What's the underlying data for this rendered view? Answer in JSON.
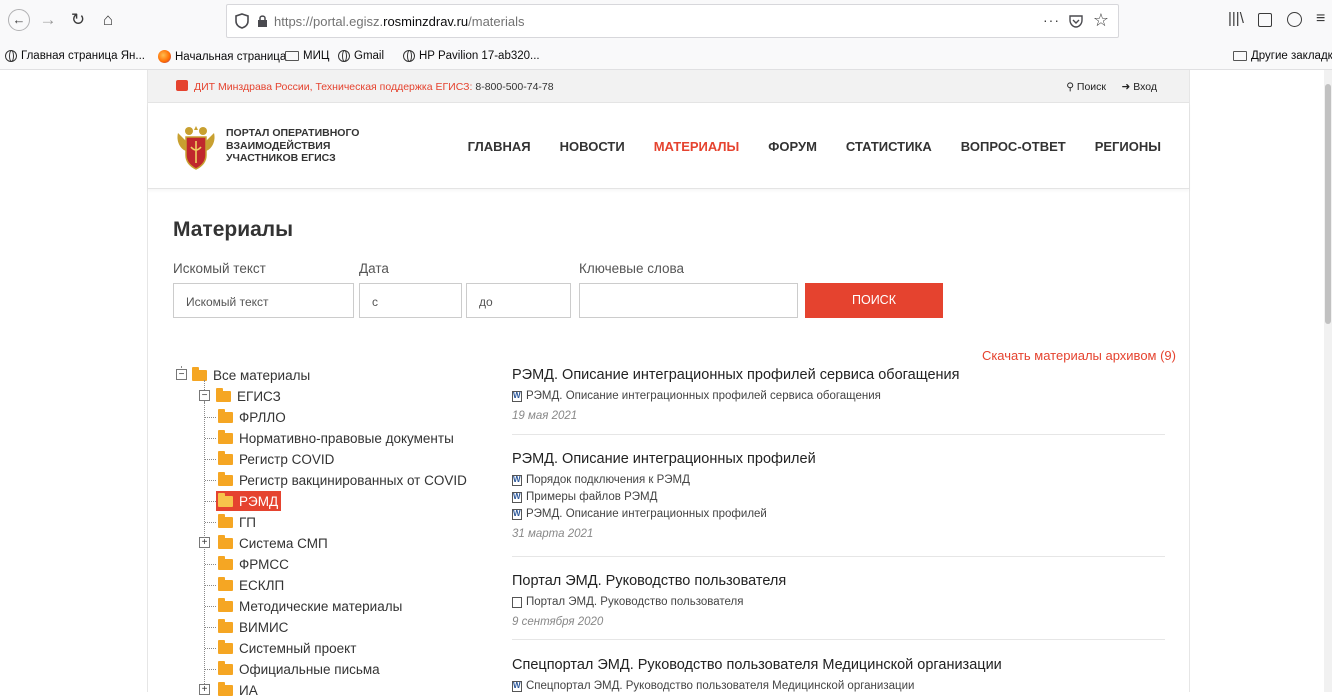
{
  "browser": {
    "url_prefix": "https://portal.egisz.",
    "url_host": "rosminzdrav.ru",
    "url_suffix": "/materials",
    "more": "···",
    "bookmarks": [
      {
        "label": "Главная страница Ян...",
        "icon": "globe-icon"
      },
      {
        "label": "Начальная страница",
        "icon": "firefox-icon"
      },
      {
        "label": "МИЦ",
        "icon": "folder-icon"
      },
      {
        "label": "Gmail",
        "icon": "globe-icon"
      },
      {
        "label": "HP Pavilion 17-ab320...",
        "icon": "globe-icon"
      }
    ],
    "other_bookmarks": "Другие закладки"
  },
  "topbar": {
    "org": "ДИТ Минздрава России,",
    "support": "Техническая поддержка ЕГИСЗ:",
    "phone": "8-800-500-74-78",
    "search": "Поиск",
    "login": "Вход"
  },
  "header": {
    "logo_lines": [
      "ПОРТАЛ ОПЕРАТИВНОГО",
      "ВЗАИМОДЕЙСТВИЯ",
      "УЧАСТНИКОВ ЕГИСЗ"
    ],
    "menu": [
      "ГЛАВНАЯ",
      "НОВОСТИ",
      "МАТЕРИАЛЫ",
      "ФОРУМ",
      "СТАТИСТИКА",
      "ВОПРОС-ОТВЕТ",
      "РЕГИОНЫ"
    ],
    "active_menu": "МАТЕРИАЛЫ"
  },
  "page_title": "Материалы",
  "filters": {
    "text_label": "Искомый текст",
    "text_placeholder": "Искомый текст",
    "date_label": "Дата",
    "date_from": "с",
    "date_to": "до",
    "keywords_label": "Ключевые слова",
    "keywords_value": "",
    "search_button": "ПОИСК"
  },
  "download_link": "Скачать материалы архивом (9)",
  "tree": {
    "root": "Все материалы",
    "egisz": "ЕГИСЗ",
    "children": [
      "ФРЛЛО",
      "Нормативно-правовые документы",
      "Регистр COVID",
      "Регистр вакцинированных от COVID",
      "РЭМД",
      "ГП",
      "Система СМП",
      "ФРМСС",
      "ЕСКЛП",
      "Методические материалы",
      "ВИМИС",
      "Системный проект",
      "Официальные письма",
      "ИА"
    ],
    "selected": "РЭМД"
  },
  "materials": [
    {
      "title": "РЭМД. Описание интеграционных профилей сервиса обогащения",
      "files": [
        {
          "name": "РЭМД. Описание интеграционных профилей сервиса обогащения",
          "icon": "word-icon"
        }
      ],
      "date": "19 мая 2021"
    },
    {
      "title": "РЭМД. Описание интеграционных профилей",
      "files": [
        {
          "name": "Порядок подключения к РЭМД",
          "icon": "word-icon"
        },
        {
          "name": "Примеры файлов РЭМД",
          "icon": "word-icon"
        },
        {
          "name": "РЭМД. Описание интеграционных профилей",
          "icon": "word-icon"
        }
      ],
      "date": "31 марта 2021"
    },
    {
      "title": "Портал ЭМД. Руководство пользователя",
      "files": [
        {
          "name": "Портал ЭМД. Руководство пользователя",
          "icon": "file-icon"
        }
      ],
      "date": "9 сентября 2020"
    },
    {
      "title": "Спецпортал ЭМД. Руководство пользователя Медицинской организации",
      "files": [
        {
          "name": "Спецпортал ЭМД. Руководство пользователя Медицинской организации",
          "icon": "word-icon"
        }
      ],
      "date": ""
    }
  ],
  "colors": {
    "accent": "#e5432f",
    "folder": "#f5a623"
  }
}
